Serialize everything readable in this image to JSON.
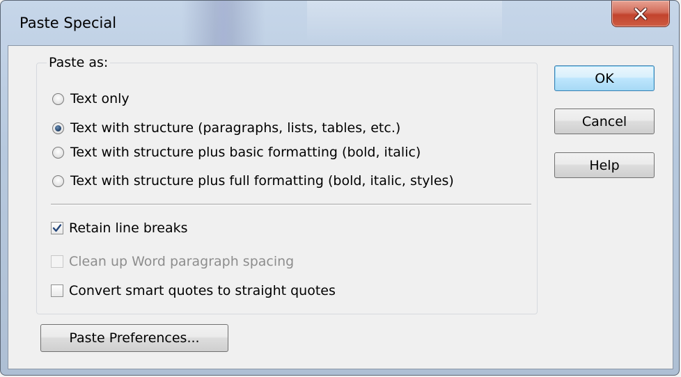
{
  "window": {
    "title": "Paste Special"
  },
  "paste_as": {
    "legend": "Paste as:",
    "options": [
      {
        "label": "Text only",
        "checked": false
      },
      {
        "label": "Text with structure (paragraphs, lists, tables, etc.)",
        "checked": true
      },
      {
        "label": "Text with structure plus basic formatting (bold, italic)",
        "checked": false
      },
      {
        "label": "Text with structure plus full formatting (bold, italic, styles)",
        "checked": false
      }
    ]
  },
  "checkboxes": [
    {
      "label": "Retain line breaks",
      "checked": true,
      "enabled": true
    },
    {
      "label": "Clean up Word paragraph spacing",
      "checked": false,
      "enabled": false
    },
    {
      "label": "Convert smart quotes to straight quotes",
      "checked": false,
      "enabled": true
    }
  ],
  "buttons": {
    "ok": "OK",
    "cancel": "Cancel",
    "help": "Help",
    "preferences": "Paste Preferences..."
  },
  "icons": {
    "close": "close-icon",
    "check": "checkmark-icon"
  },
  "colors": {
    "close_button": "#c2432d",
    "default_button_border": "#3c7fb1",
    "disabled_text": "#8d8d8d"
  }
}
